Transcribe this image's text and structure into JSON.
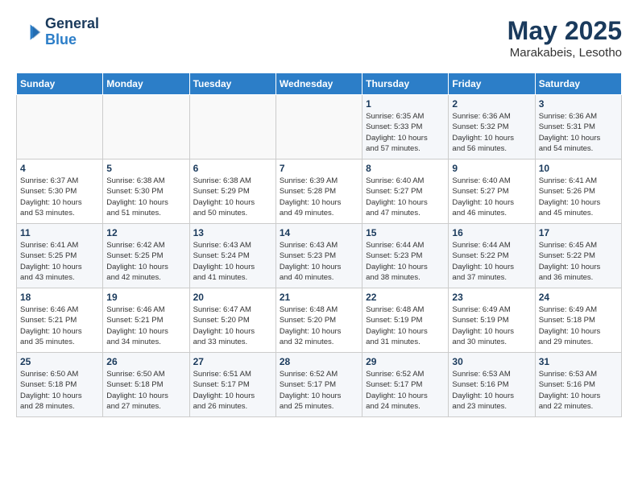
{
  "header": {
    "logo_line1": "General",
    "logo_line2": "Blue",
    "month": "May 2025",
    "location": "Marakabeis, Lesotho"
  },
  "days_of_week": [
    "Sunday",
    "Monday",
    "Tuesday",
    "Wednesday",
    "Thursday",
    "Friday",
    "Saturday"
  ],
  "weeks": [
    [
      {
        "day": "",
        "info": ""
      },
      {
        "day": "",
        "info": ""
      },
      {
        "day": "",
        "info": ""
      },
      {
        "day": "",
        "info": ""
      },
      {
        "day": "1",
        "info": "Sunrise: 6:35 AM\nSunset: 5:33 PM\nDaylight: 10 hours\nand 57 minutes."
      },
      {
        "day": "2",
        "info": "Sunrise: 6:36 AM\nSunset: 5:32 PM\nDaylight: 10 hours\nand 56 minutes."
      },
      {
        "day": "3",
        "info": "Sunrise: 6:36 AM\nSunset: 5:31 PM\nDaylight: 10 hours\nand 54 minutes."
      }
    ],
    [
      {
        "day": "4",
        "info": "Sunrise: 6:37 AM\nSunset: 5:30 PM\nDaylight: 10 hours\nand 53 minutes."
      },
      {
        "day": "5",
        "info": "Sunrise: 6:38 AM\nSunset: 5:30 PM\nDaylight: 10 hours\nand 51 minutes."
      },
      {
        "day": "6",
        "info": "Sunrise: 6:38 AM\nSunset: 5:29 PM\nDaylight: 10 hours\nand 50 minutes."
      },
      {
        "day": "7",
        "info": "Sunrise: 6:39 AM\nSunset: 5:28 PM\nDaylight: 10 hours\nand 49 minutes."
      },
      {
        "day": "8",
        "info": "Sunrise: 6:40 AM\nSunset: 5:27 PM\nDaylight: 10 hours\nand 47 minutes."
      },
      {
        "day": "9",
        "info": "Sunrise: 6:40 AM\nSunset: 5:27 PM\nDaylight: 10 hours\nand 46 minutes."
      },
      {
        "day": "10",
        "info": "Sunrise: 6:41 AM\nSunset: 5:26 PM\nDaylight: 10 hours\nand 45 minutes."
      }
    ],
    [
      {
        "day": "11",
        "info": "Sunrise: 6:41 AM\nSunset: 5:25 PM\nDaylight: 10 hours\nand 43 minutes."
      },
      {
        "day": "12",
        "info": "Sunrise: 6:42 AM\nSunset: 5:25 PM\nDaylight: 10 hours\nand 42 minutes."
      },
      {
        "day": "13",
        "info": "Sunrise: 6:43 AM\nSunset: 5:24 PM\nDaylight: 10 hours\nand 41 minutes."
      },
      {
        "day": "14",
        "info": "Sunrise: 6:43 AM\nSunset: 5:23 PM\nDaylight: 10 hours\nand 40 minutes."
      },
      {
        "day": "15",
        "info": "Sunrise: 6:44 AM\nSunset: 5:23 PM\nDaylight: 10 hours\nand 38 minutes."
      },
      {
        "day": "16",
        "info": "Sunrise: 6:44 AM\nSunset: 5:22 PM\nDaylight: 10 hours\nand 37 minutes."
      },
      {
        "day": "17",
        "info": "Sunrise: 6:45 AM\nSunset: 5:22 PM\nDaylight: 10 hours\nand 36 minutes."
      }
    ],
    [
      {
        "day": "18",
        "info": "Sunrise: 6:46 AM\nSunset: 5:21 PM\nDaylight: 10 hours\nand 35 minutes."
      },
      {
        "day": "19",
        "info": "Sunrise: 6:46 AM\nSunset: 5:21 PM\nDaylight: 10 hours\nand 34 minutes."
      },
      {
        "day": "20",
        "info": "Sunrise: 6:47 AM\nSunset: 5:20 PM\nDaylight: 10 hours\nand 33 minutes."
      },
      {
        "day": "21",
        "info": "Sunrise: 6:48 AM\nSunset: 5:20 PM\nDaylight: 10 hours\nand 32 minutes."
      },
      {
        "day": "22",
        "info": "Sunrise: 6:48 AM\nSunset: 5:19 PM\nDaylight: 10 hours\nand 31 minutes."
      },
      {
        "day": "23",
        "info": "Sunrise: 6:49 AM\nSunset: 5:19 PM\nDaylight: 10 hours\nand 30 minutes."
      },
      {
        "day": "24",
        "info": "Sunrise: 6:49 AM\nSunset: 5:18 PM\nDaylight: 10 hours\nand 29 minutes."
      }
    ],
    [
      {
        "day": "25",
        "info": "Sunrise: 6:50 AM\nSunset: 5:18 PM\nDaylight: 10 hours\nand 28 minutes."
      },
      {
        "day": "26",
        "info": "Sunrise: 6:50 AM\nSunset: 5:18 PM\nDaylight: 10 hours\nand 27 minutes."
      },
      {
        "day": "27",
        "info": "Sunrise: 6:51 AM\nSunset: 5:17 PM\nDaylight: 10 hours\nand 26 minutes."
      },
      {
        "day": "28",
        "info": "Sunrise: 6:52 AM\nSunset: 5:17 PM\nDaylight: 10 hours\nand 25 minutes."
      },
      {
        "day": "29",
        "info": "Sunrise: 6:52 AM\nSunset: 5:17 PM\nDaylight: 10 hours\nand 24 minutes."
      },
      {
        "day": "30",
        "info": "Sunrise: 6:53 AM\nSunset: 5:16 PM\nDaylight: 10 hours\nand 23 minutes."
      },
      {
        "day": "31",
        "info": "Sunrise: 6:53 AM\nSunset: 5:16 PM\nDaylight: 10 hours\nand 22 minutes."
      }
    ]
  ]
}
